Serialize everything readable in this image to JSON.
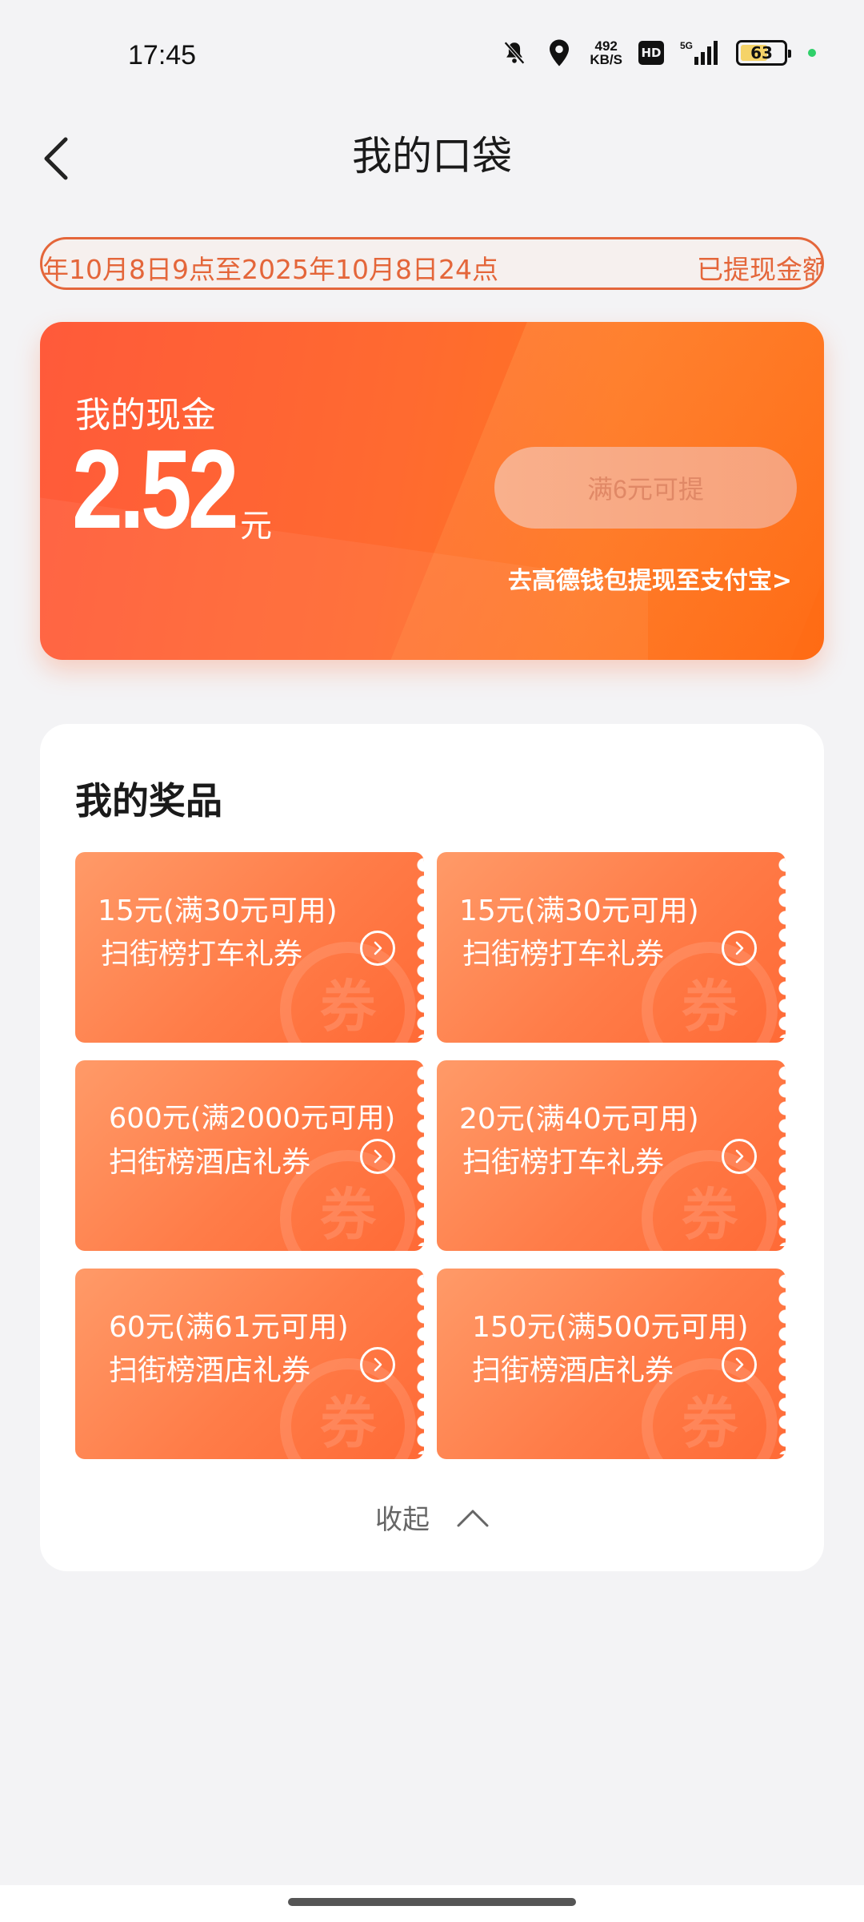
{
  "status_bar": {
    "time": "17:45",
    "net_speed_value": "492",
    "net_speed_unit": "KB/S",
    "hd": "HD",
    "network": "5G",
    "battery": "63",
    "battery_level": 0.63
  },
  "header": {
    "title": "我的口袋"
  },
  "marquee": {
    "text": "年10月8日9点至2025年10月8日24点",
    "text_right": "已提现金额"
  },
  "cash": {
    "label": "我的现金",
    "amount": "2.52",
    "unit": "元",
    "withdraw_button": "满6元可提",
    "wallet_link": "去高德钱包提现至支付宝>"
  },
  "prizes": {
    "title": "我的奖品",
    "coupons": [
      {
        "value": "15元(满30元可用)",
        "name": "扫街榜打车礼券"
      },
      {
        "value": "15元(满30元可用)",
        "name": "扫街榜打车礼券"
      },
      {
        "value": "600元(满2000元可用)",
        "name": "扫街榜酒店礼券"
      },
      {
        "value": "20元(满40元可用)",
        "name": "扫街榜打车礼券"
      },
      {
        "value": "60元(满61元可用)",
        "name": "扫街榜酒店礼券"
      },
      {
        "value": "150元(满500元可用)",
        "name": "扫街榜酒店礼券"
      }
    ],
    "watermark": "券",
    "collapse_label": "收起"
  },
  "colors": {
    "accent": "#ff6a30",
    "marquee": "#e4663a"
  }
}
